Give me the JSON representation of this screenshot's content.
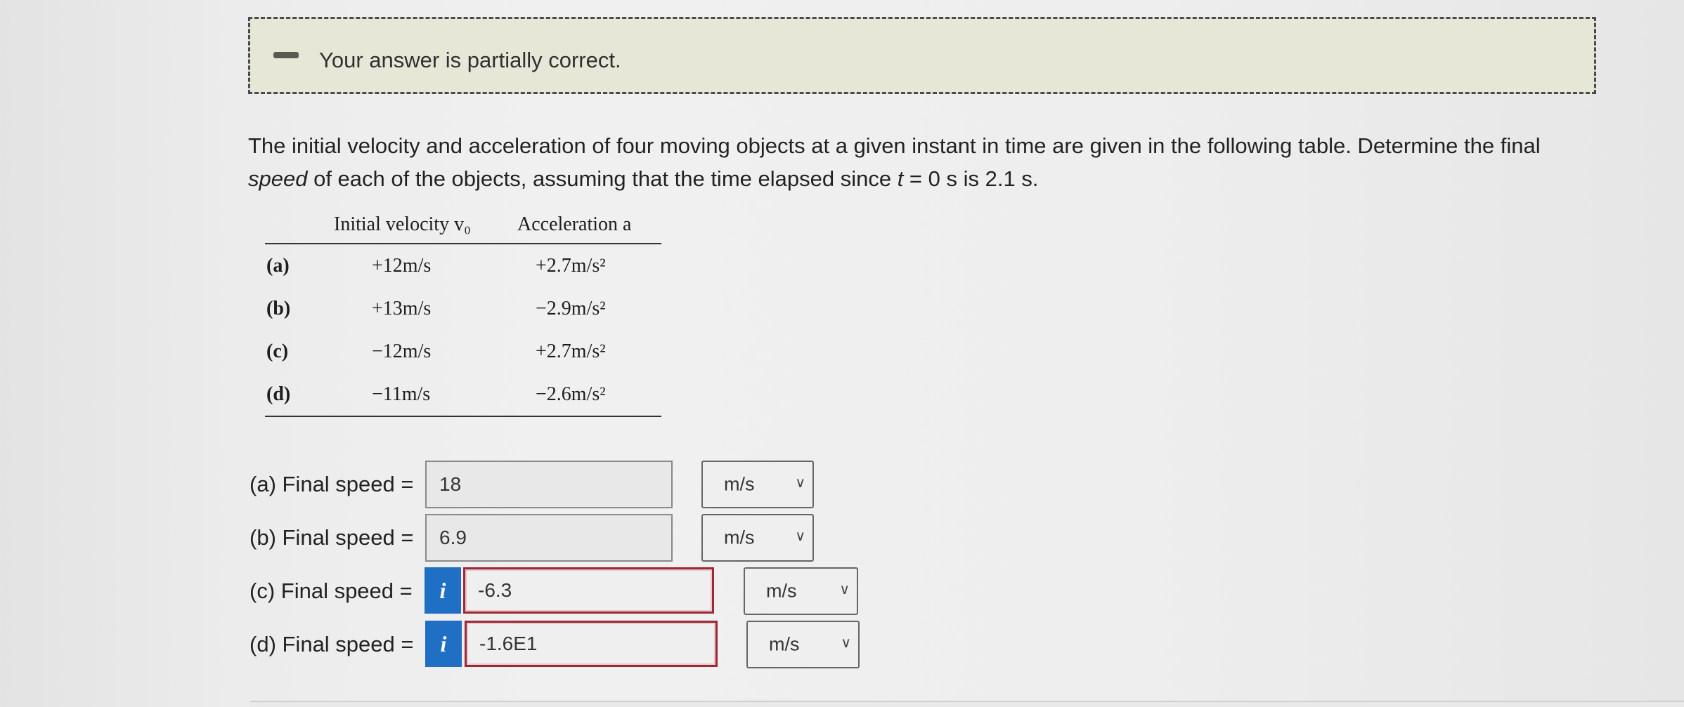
{
  "feedback": {
    "message": "Your answer is partially correct.",
    "icon": "minus-icon"
  },
  "question": {
    "part1": "The initial velocity and acceleration of four moving objects at a given instant in time are given in the following table. Determine the final ",
    "emphasis": "speed",
    "part2": " of each of the objects, assuming that the time elapsed since ",
    "time_var": "t",
    "part3": " = 0 s is 2.1 s."
  },
  "table": {
    "headers": {
      "velocity": "Initial velocity v₀",
      "acceleration": "Acceleration a"
    },
    "rows": [
      {
        "label": "(a)",
        "velocity": "+12m/s",
        "acceleration": "+2.7m/s²"
      },
      {
        "label": "(b)",
        "velocity": "+13m/s",
        "acceleration": "−2.9m/s²"
      },
      {
        "label": "(c)",
        "velocity": "−12m/s",
        "acceleration": "+2.7m/s²"
      },
      {
        "label": "(d)",
        "velocity": "−11m/s",
        "acceleration": "−2.6m/s²"
      }
    ]
  },
  "answers": [
    {
      "label": "(a) Final speed =",
      "value": "18",
      "unit": "m/s",
      "status": "neutral"
    },
    {
      "label": "(b) Final speed =",
      "value": "6.9",
      "unit": "m/s",
      "status": "neutral"
    },
    {
      "label": "(c) Final speed =",
      "value": "-6.3",
      "unit": "m/s",
      "status": "incorrect"
    },
    {
      "label": "(d) Final speed =",
      "value": "-1.6E1",
      "unit": "m/s",
      "status": "incorrect"
    }
  ],
  "info_button": {
    "glyph": "i",
    "icon": "info-icon"
  },
  "colors": {
    "banner_bg": "#e6e7d6",
    "info_blue": "#1f6fc4",
    "incorrect_border": "#9b2a36"
  }
}
